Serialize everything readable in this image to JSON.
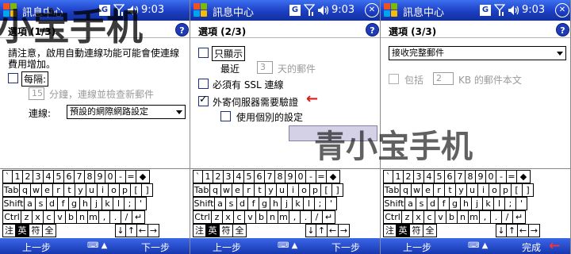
{
  "watermark": "小宝手机",
  "watermark2": "青小宝手机",
  "panels": [
    {
      "title": "訊息中心",
      "time": "9:03",
      "signal_badge": "G",
      "header": "選項 (1/3)",
      "help": "?",
      "notice": [
        "請注意，啟用自動連線功能可能會使連線",
        "費用增加。"
      ],
      "every_label": "每隔:",
      "every_value": "15",
      "every_suffix": "分鐘，連線並檢查新郵件",
      "connection_label": "連線:",
      "connection_value": "預設的網際網路設定",
      "left_soft": "上一步",
      "right_soft": "下一步"
    },
    {
      "title": "訊息中心",
      "time": "9:03",
      "signal_badge": "G",
      "header": "選項 (2/3)",
      "help": "?",
      "only_show": "只顯示",
      "recent": "最近",
      "recent_value": "3",
      "recent_suffix": "天的郵件",
      "ssl": "必須有 SSL 連線",
      "outgoing_auth": "外寄伺服器需要驗證",
      "separate": "使用個別的設定",
      "left_soft": "上一步",
      "right_soft": "下一步"
    },
    {
      "title": "訊息中心",
      "time": "9:03",
      "signal_badge": "G",
      "header": "選項 (3/3)",
      "help": "?",
      "download": "接收完整郵件",
      "include": "包括",
      "kb_value": "2",
      "kb_suffix": "KB 的郵件本文",
      "left_soft": "上一步",
      "right_soft": "完成"
    }
  ],
  "keyboard": {
    "row1": [
      "`",
      "1",
      "2",
      "3",
      "4",
      "5",
      "6",
      "7",
      "8",
      "9",
      "0",
      "-",
      "=",
      "◆"
    ],
    "row2": [
      "Tab",
      "q",
      "w",
      "e",
      "r",
      "t",
      "y",
      "u",
      "i",
      "o",
      "p",
      "[",
      "]"
    ],
    "row3": [
      "Shift",
      "a",
      "s",
      "d",
      "f",
      "g",
      "h",
      "j",
      "k",
      "l",
      ";",
      "'"
    ],
    "row4": [
      "Ctrl",
      "z",
      "x",
      "c",
      "v",
      "b",
      "n",
      "m",
      ",",
      ".",
      "/",
      "↵"
    ],
    "row5": [
      "注",
      "英",
      "符",
      "全",
      "↓",
      "↑",
      "←",
      "→"
    ]
  },
  "kb_toggle": "⌨ ▲"
}
